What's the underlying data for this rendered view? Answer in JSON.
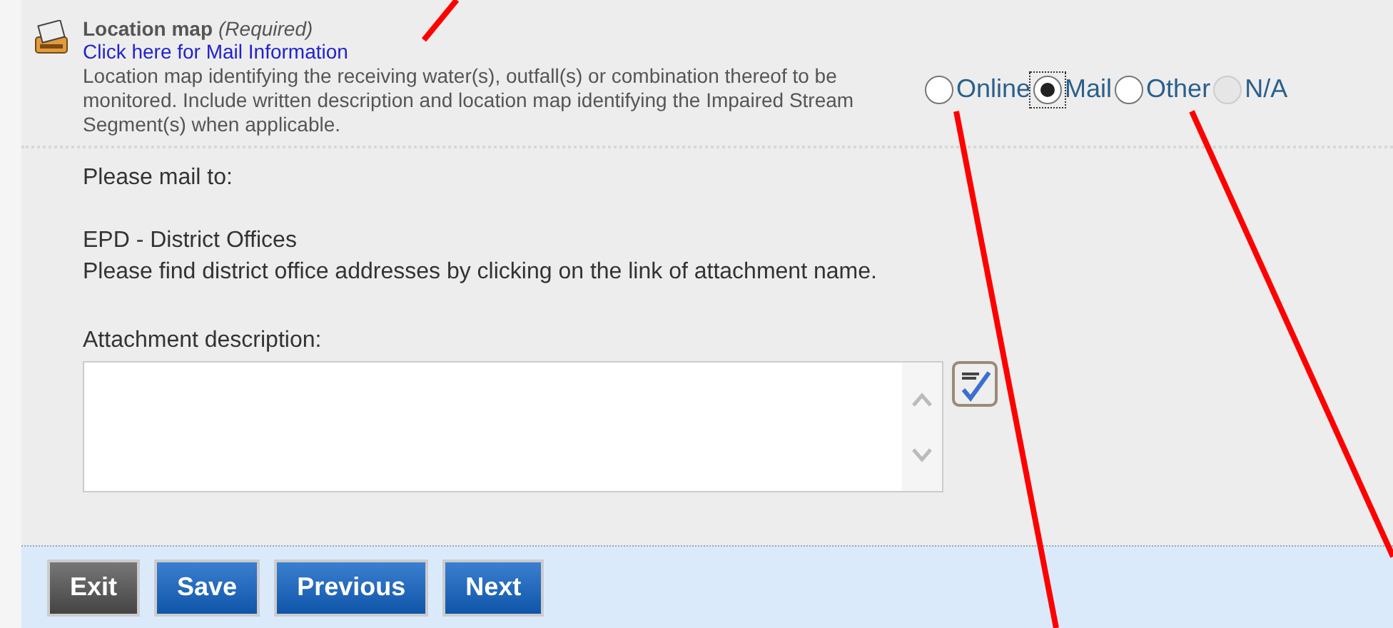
{
  "item": {
    "title": "Location map",
    "required_note": "(Required)",
    "link": "Click here for Mail Information",
    "description": "Location map identifying the receiving water(s), outfall(s) or combination thereof to be monitored. Include written description and location map identifying the Impaired Stream Segment(s) when applicable."
  },
  "submission_options": [
    {
      "label": "Online",
      "selected": false,
      "disabled": false
    },
    {
      "label": "Mail",
      "selected": true,
      "disabled": false
    },
    {
      "label": "Other",
      "selected": false,
      "disabled": false
    },
    {
      "label": "N/A",
      "selected": false,
      "disabled": true
    }
  ],
  "mail_info": {
    "heading": "Please mail to:",
    "office": "EPD - District Offices",
    "instructions": "Please find district office addresses by clicking on the link of attachment name."
  },
  "attachment": {
    "label": "Attachment description:"
  },
  "buttons": [
    {
      "label": "Exit",
      "kind": "neutral"
    },
    {
      "label": "Save",
      "kind": "primary"
    },
    {
      "label": "Previous",
      "kind": "primary"
    },
    {
      "label": "Next",
      "kind": "primary"
    }
  ]
}
